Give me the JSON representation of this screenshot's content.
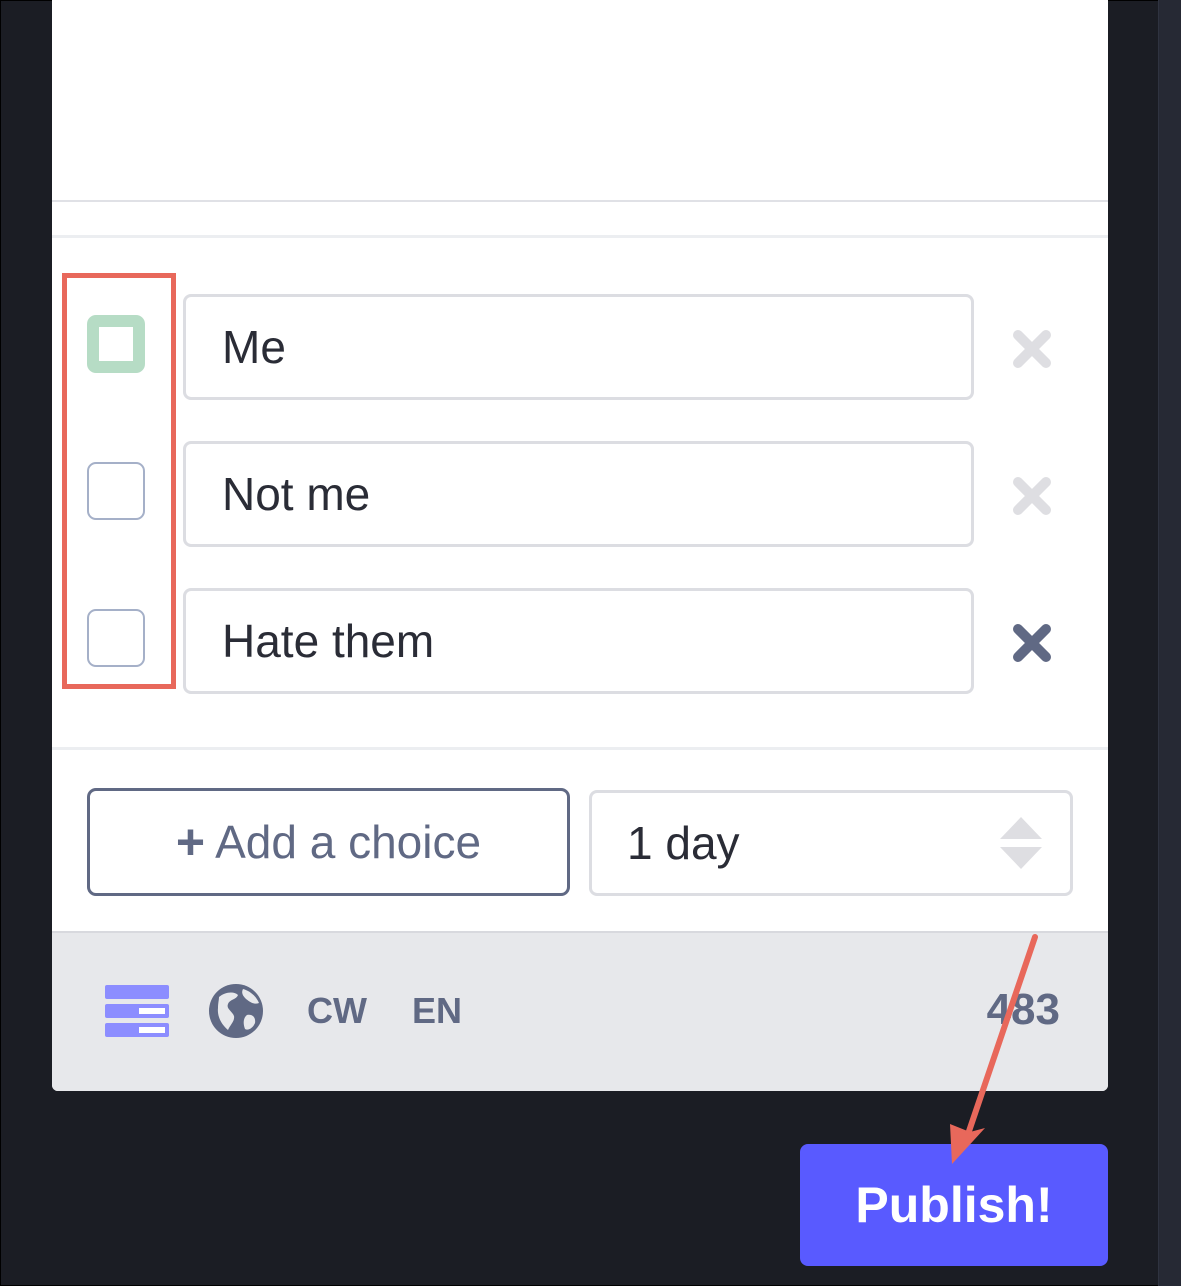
{
  "poll": {
    "options": [
      {
        "value": "Me",
        "checkbox_active": true,
        "remove_enabled": false
      },
      {
        "value": "Not me",
        "checkbox_active": false,
        "remove_enabled": false
      },
      {
        "value": "Hate them",
        "checkbox_active": false,
        "remove_enabled": true
      }
    ],
    "add_choice_label": "Add a choice",
    "duration_value": "1 day"
  },
  "footer": {
    "visibility_icon": "globe-icon",
    "poll_icon": "poll-icon",
    "cw_label": "CW",
    "language_label": "EN",
    "char_count": "483"
  },
  "publish_label": "Publish!",
  "colors": {
    "accent": "#595aff",
    "annotation": "#e8685b",
    "checkbox_active": "#b6dcc5",
    "muted": "#606984"
  }
}
